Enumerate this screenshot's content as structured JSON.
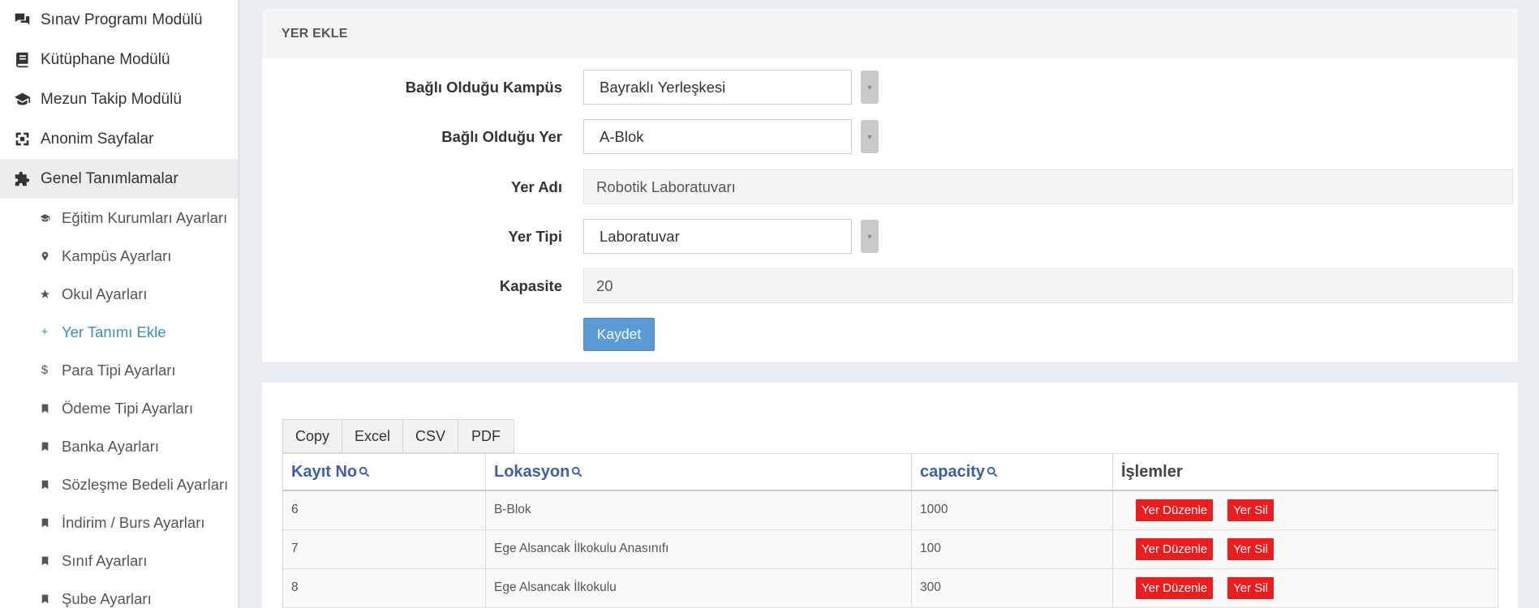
{
  "sidebar": {
    "modules": [
      {
        "label": "Sınav Programı Modülü",
        "icon": "chat-icon"
      },
      {
        "label": "Kütüphane Modülü",
        "icon": "book-icon"
      },
      {
        "label": "Mezun Takip Modülü",
        "icon": "graduation-cap-icon"
      },
      {
        "label": "Anonim Sayfalar",
        "icon": "expand-icon"
      },
      {
        "label": "Genel Tanımlamalar",
        "icon": "puzzle-icon"
      }
    ],
    "subitems": [
      {
        "label": "Eğitim Kurumları Ayarları",
        "icon": "graduation-cap-icon"
      },
      {
        "label": "Kampüs Ayarları",
        "icon": "map-marker-icon"
      },
      {
        "label": "Okul Ayarları",
        "icon": "star-icon"
      },
      {
        "label": "Yer Tanımı Ekle",
        "icon": "plus-icon"
      },
      {
        "label": "Para Tipi Ayarları",
        "icon": "dollar-icon"
      },
      {
        "label": "Ödeme Tipi Ayarları",
        "icon": "bookmark-icon"
      },
      {
        "label": "Banka Ayarları",
        "icon": "bookmark-icon"
      },
      {
        "label": "Sözleşme Bedeli Ayarları",
        "icon": "bookmark-icon"
      },
      {
        "label": "İndirim / Burs Ayarları",
        "icon": "bookmark-icon"
      },
      {
        "label": "Sınıf Ayarları",
        "icon": "bookmark-icon"
      },
      {
        "label": "Şube Ayarları",
        "icon": "bookmark-icon"
      }
    ]
  },
  "form": {
    "title": "YER EKLE",
    "campus_label": "Bağlı Olduğu Kampüs",
    "campus_value": "Bayraklı Yerleşkesi",
    "place_label": "Bağlı Olduğu Yer",
    "place_value": "A-Blok",
    "name_label": "Yer Adı",
    "name_value": "Robotik Laboratuvarı",
    "type_label": "Yer Tipi",
    "type_value": "Laboratuvar",
    "capacity_label": "Kapasite",
    "capacity_value": "20",
    "save_label": "Kaydet"
  },
  "table": {
    "export_buttons": [
      "Copy",
      "Excel",
      "CSV",
      "PDF"
    ],
    "headers": [
      "Kayıt No",
      "Lokasyon",
      "capacity",
      "İşlemler"
    ],
    "rows": [
      {
        "id": "6",
        "location": "B-Blok",
        "capacity": "1000"
      },
      {
        "id": "7",
        "location": "Ege Alsancak İlkokulu Anasınıfı",
        "capacity": "100"
      },
      {
        "id": "8",
        "location": "Ege Alsancak İlkokulu",
        "capacity": "300"
      }
    ],
    "edit_label": "Yer Düzenle",
    "delete_label": "Yer Sil"
  }
}
